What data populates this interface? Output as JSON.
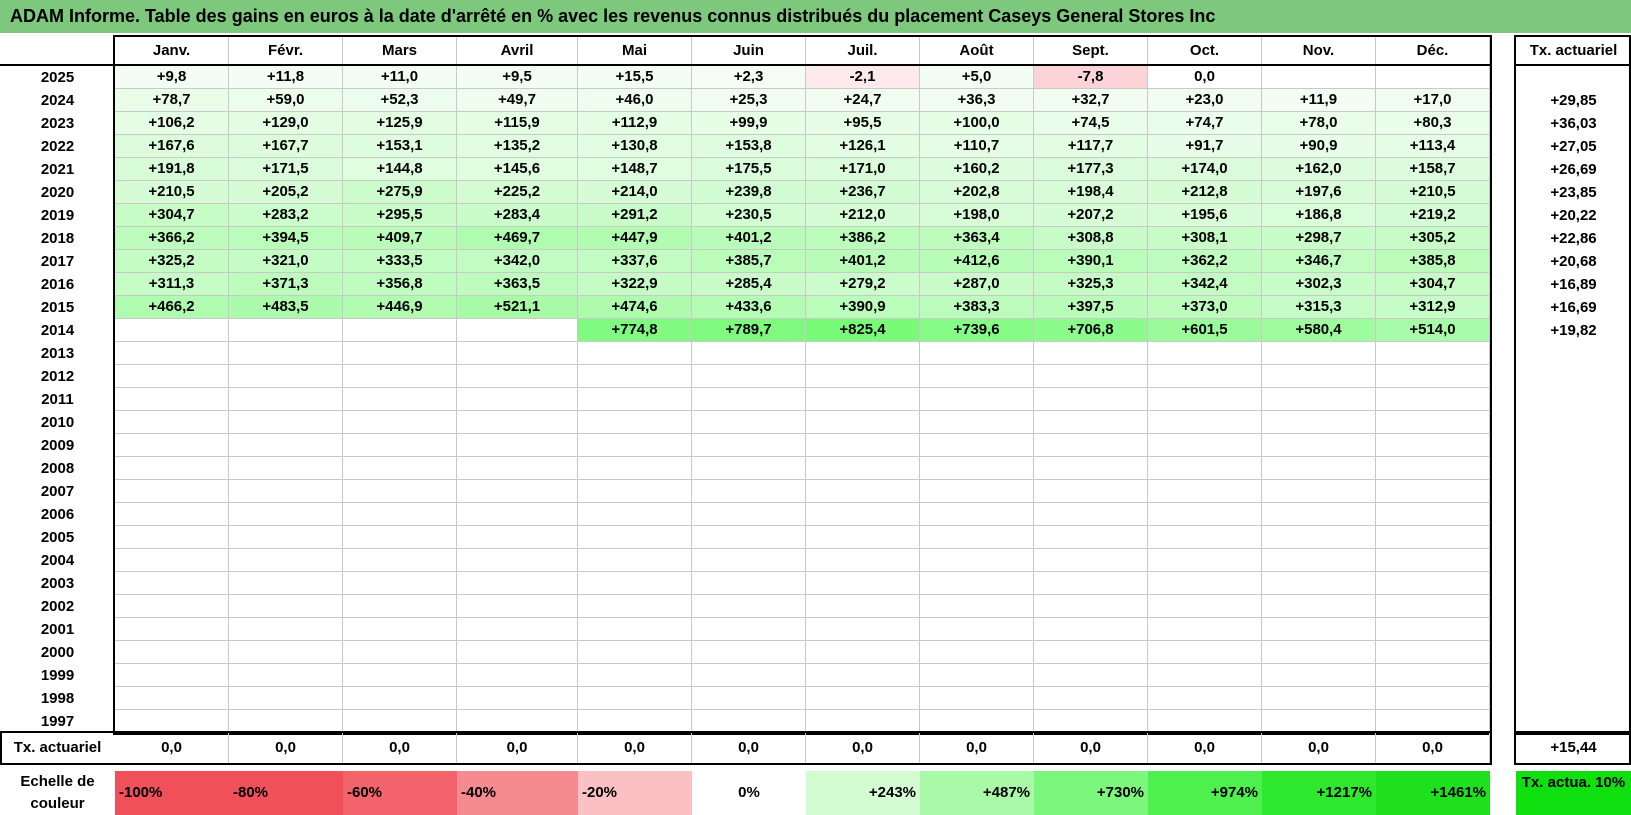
{
  "title": "ADAM Informe. Table des gains en euros à la date d'arrêté en % avec les revenus connus distribués du placement Caseys General Stores Inc",
  "months": [
    "Janv.",
    "Févr.",
    "Mars",
    "Avril",
    "Mai",
    "Juin",
    "Juil.",
    "Août",
    "Sept.",
    "Oct.",
    "Nov.",
    "Déc."
  ],
  "actuarial_header": "Tx. actuariel",
  "rows": [
    {
      "year": "2025",
      "values": [
        "+9,8",
        "+11,8",
        "+11,0",
        "+9,5",
        "+15,5",
        "+2,3",
        "-2,1",
        "+5,0",
        "-7,8",
        "0,0",
        "",
        ""
      ],
      "rate": ""
    },
    {
      "year": "2024",
      "values": [
        "+78,7",
        "+59,0",
        "+52,3",
        "+49,7",
        "+46,0",
        "+25,3",
        "+24,7",
        "+36,3",
        "+32,7",
        "+23,0",
        "+11,9",
        "+17,0"
      ],
      "rate": "+29,85"
    },
    {
      "year": "2023",
      "values": [
        "+106,2",
        "+129,0",
        "+125,9",
        "+115,9",
        "+112,9",
        "+99,9",
        "+95,5",
        "+100,0",
        "+74,5",
        "+74,7",
        "+78,0",
        "+80,3"
      ],
      "rate": "+36,03"
    },
    {
      "year": "2022",
      "values": [
        "+167,6",
        "+167,7",
        "+153,1",
        "+135,2",
        "+130,8",
        "+153,8",
        "+126,1",
        "+110,7",
        "+117,7",
        "+91,7",
        "+90,9",
        "+113,4"
      ],
      "rate": "+27,05"
    },
    {
      "year": "2021",
      "values": [
        "+191,8",
        "+171,5",
        "+144,8",
        "+145,6",
        "+148,7",
        "+175,5",
        "+171,0",
        "+160,2",
        "+177,3",
        "+174,0",
        "+162,0",
        "+158,7"
      ],
      "rate": "+26,69"
    },
    {
      "year": "2020",
      "values": [
        "+210,5",
        "+205,2",
        "+275,9",
        "+225,2",
        "+214,0",
        "+239,8",
        "+236,7",
        "+202,8",
        "+198,4",
        "+212,8",
        "+197,6",
        "+210,5"
      ],
      "rate": "+23,85"
    },
    {
      "year": "2019",
      "values": [
        "+304,7",
        "+283,2",
        "+295,5",
        "+283,4",
        "+291,2",
        "+230,5",
        "+212,0",
        "+198,0",
        "+207,2",
        "+195,6",
        "+186,8",
        "+219,2"
      ],
      "rate": "+20,22"
    },
    {
      "year": "2018",
      "values": [
        "+366,2",
        "+394,5",
        "+409,7",
        "+469,7",
        "+447,9",
        "+401,2",
        "+386,2",
        "+363,4",
        "+308,8",
        "+308,1",
        "+298,7",
        "+305,2"
      ],
      "rate": "+22,86"
    },
    {
      "year": "2017",
      "values": [
        "+325,2",
        "+321,0",
        "+333,5",
        "+342,0",
        "+337,6",
        "+385,7",
        "+401,2",
        "+412,6",
        "+390,1",
        "+362,2",
        "+346,7",
        "+385,8"
      ],
      "rate": "+20,68"
    },
    {
      "year": "2016",
      "values": [
        "+311,3",
        "+371,3",
        "+356,8",
        "+363,5",
        "+322,9",
        "+285,4",
        "+279,2",
        "+287,0",
        "+325,3",
        "+342,4",
        "+302,3",
        "+304,7"
      ],
      "rate": "+16,89"
    },
    {
      "year": "2015",
      "values": [
        "+466,2",
        "+483,5",
        "+446,9",
        "+521,1",
        "+474,6",
        "+433,6",
        "+390,9",
        "+383,3",
        "+397,5",
        "+373,0",
        "+315,3",
        "+312,9"
      ],
      "rate": "+16,69"
    },
    {
      "year": "2014",
      "values": [
        "",
        "",
        "",
        "",
        "+774,8",
        "+789,7",
        "+825,4",
        "+739,6",
        "+706,8",
        "+601,5",
        "+580,4",
        "+514,0"
      ],
      "rate": "+19,82"
    },
    {
      "year": "2013",
      "values": [
        "",
        "",
        "",
        "",
        "",
        "",
        "",
        "",
        "",
        "",
        "",
        ""
      ],
      "rate": ""
    },
    {
      "year": "2012",
      "values": [
        "",
        "",
        "",
        "",
        "",
        "",
        "",
        "",
        "",
        "",
        "",
        ""
      ],
      "rate": ""
    },
    {
      "year": "2011",
      "values": [
        "",
        "",
        "",
        "",
        "",
        "",
        "",
        "",
        "",
        "",
        "",
        ""
      ],
      "rate": ""
    },
    {
      "year": "2010",
      "values": [
        "",
        "",
        "",
        "",
        "",
        "",
        "",
        "",
        "",
        "",
        "",
        ""
      ],
      "rate": ""
    },
    {
      "year": "2009",
      "values": [
        "",
        "",
        "",
        "",
        "",
        "",
        "",
        "",
        "",
        "",
        "",
        ""
      ],
      "rate": ""
    },
    {
      "year": "2008",
      "values": [
        "",
        "",
        "",
        "",
        "",
        "",
        "",
        "",
        "",
        "",
        "",
        ""
      ],
      "rate": ""
    },
    {
      "year": "2007",
      "values": [
        "",
        "",
        "",
        "",
        "",
        "",
        "",
        "",
        "",
        "",
        "",
        ""
      ],
      "rate": ""
    },
    {
      "year": "2006",
      "values": [
        "",
        "",
        "",
        "",
        "",
        "",
        "",
        "",
        "",
        "",
        "",
        ""
      ],
      "rate": ""
    },
    {
      "year": "2005",
      "values": [
        "",
        "",
        "",
        "",
        "",
        "",
        "",
        "",
        "",
        "",
        "",
        ""
      ],
      "rate": ""
    },
    {
      "year": "2004",
      "values": [
        "",
        "",
        "",
        "",
        "",
        "",
        "",
        "",
        "",
        "",
        "",
        ""
      ],
      "rate": ""
    },
    {
      "year": "2003",
      "values": [
        "",
        "",
        "",
        "",
        "",
        "",
        "",
        "",
        "",
        "",
        "",
        ""
      ],
      "rate": ""
    },
    {
      "year": "2002",
      "values": [
        "",
        "",
        "",
        "",
        "",
        "",
        "",
        "",
        "",
        "",
        "",
        ""
      ],
      "rate": ""
    },
    {
      "year": "2001",
      "values": [
        "",
        "",
        "",
        "",
        "",
        "",
        "",
        "",
        "",
        "",
        "",
        ""
      ],
      "rate": ""
    },
    {
      "year": "2000",
      "values": [
        "",
        "",
        "",
        "",
        "",
        "",
        "",
        "",
        "",
        "",
        "",
        ""
      ],
      "rate": ""
    },
    {
      "year": "1999",
      "values": [
        "",
        "",
        "",
        "",
        "",
        "",
        "",
        "",
        "",
        "",
        "",
        ""
      ],
      "rate": ""
    },
    {
      "year": "1998",
      "values": [
        "",
        "",
        "",
        "",
        "",
        "",
        "",
        "",
        "",
        "",
        "",
        ""
      ],
      "rate": ""
    },
    {
      "year": "1997",
      "values": [
        "",
        "",
        "",
        "",
        "",
        "",
        "",
        "",
        "",
        "",
        "",
        ""
      ],
      "rate": ""
    }
  ],
  "footer": {
    "label": "Tx. actuariel",
    "values": [
      "0,0",
      "0,0",
      "0,0",
      "0,0",
      "0,0",
      "0,0",
      "0,0",
      "0,0",
      "0,0",
      "0,0",
      "0,0",
      "0,0"
    ],
    "total": "+15,44"
  },
  "scale": {
    "label": "Echelle de couleur",
    "steps": [
      {
        "label": "-100%",
        "color": "#f0505a"
      },
      {
        "label": "-80%",
        "color": "#f0505a"
      },
      {
        "label": "-60%",
        "color": "#f3636b"
      },
      {
        "label": "-40%",
        "color": "#f58a8f"
      },
      {
        "label": "-20%",
        "color": "#fac0c3"
      },
      {
        "label": "0%",
        "color": "#ffffff"
      },
      {
        "label": "+243%",
        "color": "#d3fcd3"
      },
      {
        "label": "+487%",
        "color": "#a8faa8"
      },
      {
        "label": "+730%",
        "color": "#7cf77c"
      },
      {
        "label": "+974%",
        "color": "#4df04d"
      },
      {
        "label": "+1217%",
        "color": "#2ee82e"
      },
      {
        "label": "+1461%",
        "color": "#1ee01e"
      }
    ],
    "target_label": "Tx. actua. 10%",
    "target_color": "#10e010"
  }
}
